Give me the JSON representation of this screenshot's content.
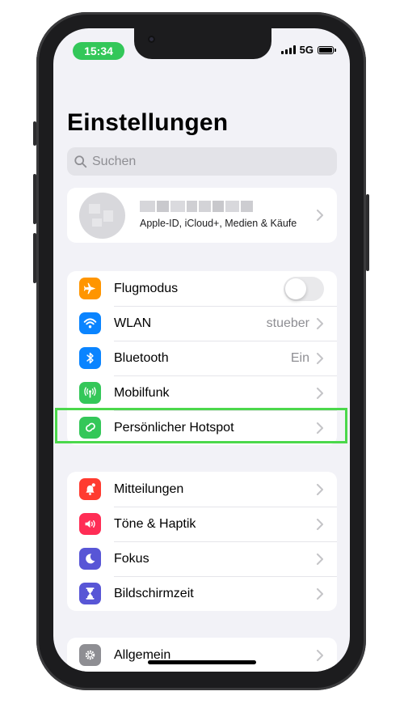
{
  "status": {
    "time": "15:34",
    "network": "5G"
  },
  "page": {
    "title": "Einstellungen"
  },
  "search": {
    "placeholder": "Suchen"
  },
  "profile": {
    "subtitle": "Apple-ID, iCloud+, Medien & Käufe"
  },
  "group1": [
    {
      "label": "Flugmodus",
      "icon": "airplane-icon",
      "color": "#ff9500",
      "toggle": false
    },
    {
      "label": "WLAN",
      "icon": "wifi-icon",
      "color": "#0a84ff",
      "value": "stueber"
    },
    {
      "label": "Bluetooth",
      "icon": "bluetooth-icon",
      "color": "#0a84ff",
      "value": "Ein"
    },
    {
      "label": "Mobilfunk",
      "icon": "antenna-icon",
      "color": "#34c759"
    },
    {
      "label": "Persönlicher Hotspot",
      "icon": "hotspot-icon",
      "color": "#34c759",
      "highlighted": true
    }
  ],
  "group2": [
    {
      "label": "Mitteilungen",
      "icon": "bell-icon",
      "color": "#ff3b30"
    },
    {
      "label": "Töne & Haptik",
      "icon": "speaker-icon",
      "color": "#ff2d55"
    },
    {
      "label": "Fokus",
      "icon": "moon-icon",
      "color": "#5856d6"
    },
    {
      "label": "Bildschirmzeit",
      "icon": "hourglass-icon",
      "color": "#5856d6"
    }
  ],
  "group3": [
    {
      "label": "Allgemein",
      "icon": "gear-icon",
      "color": "#8e8e93"
    }
  ],
  "colors": {
    "highlight_border": "#4bd84b",
    "time_pill": "#33c759"
  }
}
